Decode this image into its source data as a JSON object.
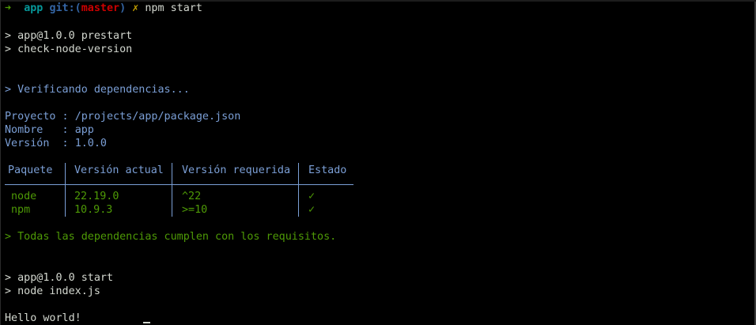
{
  "prompt": {
    "arrow": "➜",
    "dir": "app",
    "git_prefix": "git:(",
    "branch": "master",
    "git_suffix": ")",
    "dirty": "✗",
    "command": "npm start"
  },
  "prestart": {
    "line1": "> app@1.0.0 prestart",
    "line2": "> check-node-version"
  },
  "verify_message": "> Verificando dependencias...",
  "project_info": {
    "proyecto_label": "Proyecto : ",
    "proyecto_value": "/projects/app/package.json",
    "nombre_label": "Nombre   : ",
    "nombre_value": "app",
    "version_label": "Versión  : ",
    "version_value": "1.0.0"
  },
  "deps_table": {
    "headers": [
      "Paquete",
      "Versión actual",
      "Versión requerida",
      "Estado"
    ],
    "rows": [
      {
        "package": "node",
        "current": "22.19.0",
        "required": "^22",
        "status": "✓"
      },
      {
        "package": "npm",
        "current": "10.9.3",
        "required": ">=10",
        "status": "✓"
      }
    ]
  },
  "success_message": "> Todas las dependencias cumplen con los requisitos.",
  "start": {
    "line1": "> app@1.0.0 start",
    "line2": "> node index.js"
  },
  "output": "Hello world!",
  "colors": {
    "background": "#000000",
    "foreground": "#d3d7cf",
    "info_blue": "#7b9fd6",
    "success_green": "#4e9a06",
    "branch_red": "#cc0000",
    "dir_cyan": "#06989a"
  }
}
